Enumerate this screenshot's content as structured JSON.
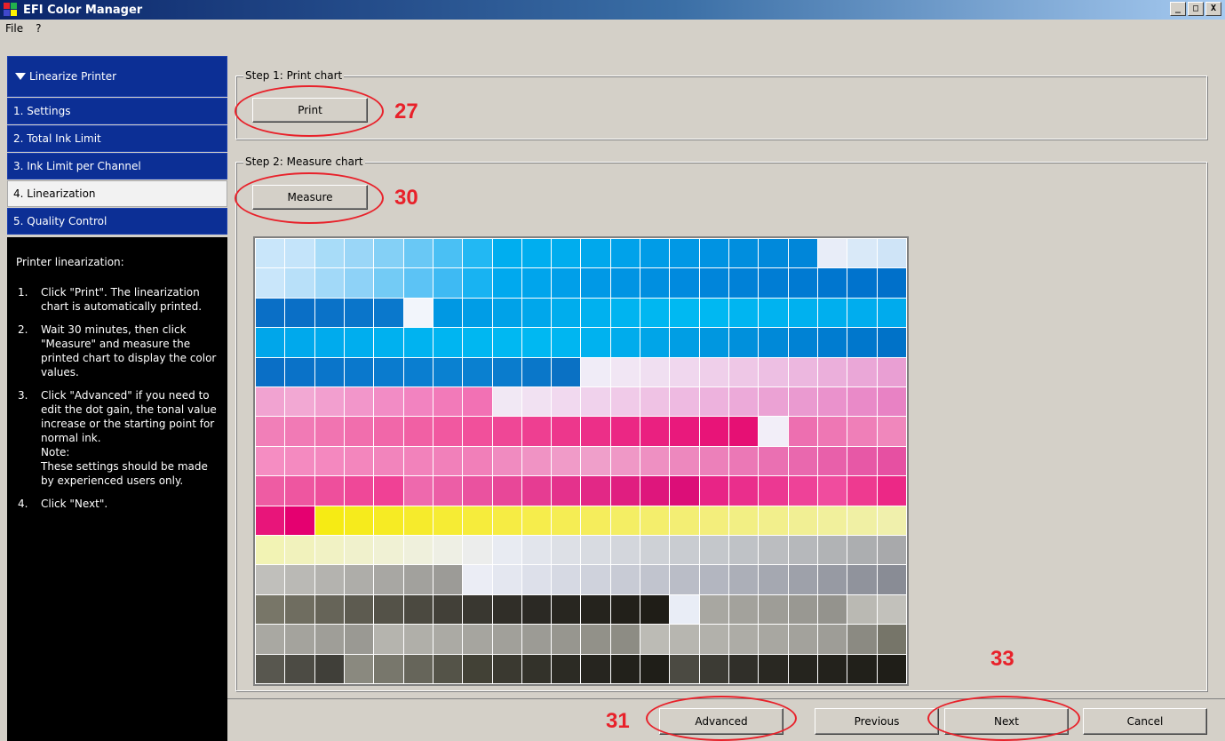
{
  "window": {
    "title": "EFI Color Manager",
    "minimize": "_",
    "maximize": "□",
    "close": "X"
  },
  "menu": [
    "File",
    "?"
  ],
  "sidebar": {
    "header": "Linearize Printer",
    "items": [
      {
        "label": "1. Settings",
        "active": false
      },
      {
        "label": "2. Total Ink Limit",
        "active": false
      },
      {
        "label": "3. Ink Limit per Channel",
        "active": false
      },
      {
        "label": "4. Linearization",
        "active": true
      },
      {
        "label": "5. Quality Control",
        "active": false
      }
    ]
  },
  "help": {
    "title": "Printer linearization:",
    "steps": [
      {
        "num": "1.",
        "text": "Click \"Print\". The linearization chart is automatically printed."
      },
      {
        "num": "2.",
        "text": "Wait 30 minutes, then click \"Measure\" and measure the printed chart to display the color values."
      },
      {
        "num": "3.",
        "text": "Click \"Advanced\" if you need to edit the dot gain, the tonal value increase or the starting point for normal ink."
      },
      {
        "num": "",
        "text": "Note:"
      },
      {
        "num": "",
        "text": "These settings should be made by experienced users only."
      },
      {
        "num": "4.",
        "text": "Click \"Next\"."
      }
    ]
  },
  "step1": {
    "legend": "Step 1: Print chart",
    "button": "Print"
  },
  "step2": {
    "legend": "Step 2: Measure chart",
    "button": "Measure"
  },
  "bottom": {
    "advanced": "Advanced",
    "previous": "Previous",
    "next": "Next",
    "cancel": "Cancel"
  },
  "annotations": {
    "print": "27",
    "measure": "30",
    "advanced": "31",
    "next": "33"
  },
  "colors": {
    "annotation": "#e8212a",
    "nav_blue": "#0c2f95"
  },
  "patch_rows": [
    [
      "#c9e6fa",
      "#c4e4fa",
      "#a8dcf8",
      "#9ad6f7",
      "#84d0f6",
      "#69c8f5",
      "#4ac0f4",
      "#22b8f3",
      "#00aeef",
      "#00aeef",
      "#00adee",
      "#00a8ec",
      "#00a2ea",
      "#009ce7",
      "#0098e5",
      "#0093e2",
      "#008ede",
      "#0089db",
      "#0086d9",
      "#e8edf8",
      "#d9e9f8",
      "#cfe4f7"
    ],
    [
      "#c9e6fa",
      "#b8e0f9",
      "#a2d9f8",
      "#8ed2f7",
      "#73cbf5",
      "#5cc3f5",
      "#3ebaf3",
      "#18b3f2",
      "#00a9ee",
      "#00a5ec",
      "#009fe9",
      "#0099e6",
      "#0094e3",
      "#008fe0",
      "#008ade",
      "#0085da",
      "#0081d7",
      "#007dd4",
      "#007ad2",
      "#0076cf",
      "#0073cd",
      "#0070ca"
    ],
    [
      "#0a6fc6",
      "#0a6fc6",
      "#0a72c8",
      "#0a75ca",
      "#0a78cc",
      "#f2f5fb",
      "#0098e3",
      "#009de6",
      "#00a2e8",
      "#00a7eb",
      "#00aded",
      "#00b1ef",
      "#00b4f0",
      "#00b7f1",
      "#00b9f2",
      "#00b8f2",
      "#00b5f1",
      "#00b3f0",
      "#00b1ef",
      "#00afee",
      "#00adee",
      "#00abed"
    ],
    [
      "#00a6ea",
      "#00a9ec",
      "#00abed",
      "#00aeee",
      "#00b1ef",
      "#00b3f0",
      "#00b5f1",
      "#00b7f1",
      "#00b8f2",
      "#00b8f2",
      "#00b6f1",
      "#00b2ef",
      "#00acec",
      "#00a5e8",
      "#009ee4",
      "#0097e0",
      "#0090dc",
      "#0089d8",
      "#0082d4",
      "#007cd0",
      "#0077cc",
      "#0072c8"
    ],
    [
      "#0a6fc6",
      "#0a72c8",
      "#0a75ca",
      "#0a78cc",
      "#0a7bce",
      "#0a7ed0",
      "#0a81d1",
      "#0a80d0",
      "#0a7ccd",
      "#0a77c9",
      "#0a71c4",
      "#f0ecf7",
      "#f1e6f4",
      "#f0dff1",
      "#f0d7ee",
      "#efcfea",
      "#eec7e6",
      "#edbfe3",
      "#ecb7df",
      "#ebafdb",
      "#eaa7d7",
      "#e99fd3"
    ],
    [
      "#f1a3d1",
      "#f2a8d3",
      "#f29fcf",
      "#f296ca",
      "#f28cc5",
      "#f283c0",
      "#f27ab9",
      "#f271b4",
      "#f1e8f4",
      "#f1e1f2",
      "#f1d9ef",
      "#f0d2ec",
      "#f0cae8",
      "#efc2e4",
      "#eebae1",
      "#edb2dd",
      "#ecaad9",
      "#eba2d4",
      "#ea9ad0",
      "#ea92cc",
      "#e98ac8",
      "#e882c4"
    ],
    [
      "#f17fb8",
      "#f17ab5",
      "#f174b1",
      "#f16ead",
      "#f167a9",
      "#f160a4",
      "#f158a0",
      "#f1509b",
      "#ef4796",
      "#ee3f91",
      "#ed378c",
      "#ec2f88",
      "#eb2784",
      "#ea2080",
      "#e9197c",
      "#e81478",
      "#e61074",
      "#f2eef8",
      "#ed6fb0",
      "#ee77b4",
      "#ef7fb8",
      "#f087bc"
    ],
    [
      "#f58dc2",
      "#f48ac0",
      "#f488bf",
      "#f386bd",
      "#f284bc",
      "#f282bb",
      "#f180ba",
      "#f17fb9",
      "#f08bc0",
      "#f093c4",
      "#f09bc8",
      "#ef9fca",
      "#ef98c6",
      "#ee90c2",
      "#ed88be",
      "#ec80ba",
      "#eb78b6",
      "#ea70b2",
      "#e968ae",
      "#e860aa",
      "#e758a6",
      "#e650a2"
    ],
    [
      "#ee5ca3",
      "#ee56a0",
      "#ee4f9c",
      "#ef4898",
      "#f04195",
      "#ee69ad",
      "#ec5ea6",
      "#ea529f",
      "#e84798",
      "#e63c92",
      "#e4328c",
      "#e22886",
      "#e01e80",
      "#de167c",
      "#dc0e78",
      "#e82486",
      "#ea2e8c",
      "#ec3892",
      "#ee4298",
      "#f04c9e",
      "#ee3a90",
      "#ec2886"
    ],
    [
      "#e8157a",
      "#e50070",
      "#f6eb14",
      "#f6eb1c",
      "#f6eb24",
      "#f6eb2c",
      "#f6ec34",
      "#f6ec3c",
      "#f6ec44",
      "#f6ed4c",
      "#f5ed54",
      "#f5ed5c",
      "#f4ee64",
      "#f4ee6c",
      "#f3ee74",
      "#f3ee7c",
      "#f2ef84",
      "#f2ef8c",
      "#f1ef94",
      "#f1f09c",
      "#f0f0a4",
      "#f0f0ac"
    ],
    [
      "#f2f3b4",
      "#f1f2bc",
      "#f1f2c4",
      "#f0f1cc",
      "#f0f1d4",
      "#eff0dc",
      "#eeefe4",
      "#ecedec",
      "#e8ebf2",
      "#e2e5ec",
      "#dde0e6",
      "#d8dbe1",
      "#d3d6dc",
      "#ced1d6",
      "#c9ccd1",
      "#c4c7cb",
      "#bfc2c6",
      "#bbbdc0",
      "#b6b8bb",
      "#b1b3b5",
      "#acaeb0",
      "#a8a9ab"
    ],
    [
      "#c0bfbb",
      "#bab9b5",
      "#b4b3af",
      "#aeada9",
      "#a8a7a3",
      "#a2a19d",
      "#9c9b97",
      "#ebedf5",
      "#e4e7f0",
      "#dde0ea",
      "#d6d9e3",
      "#cfd2dc",
      "#c8cbd5",
      "#c1c4ce",
      "#babdc7",
      "#b3b6c0",
      "#acafb8",
      "#a5a8b1",
      "#9ea1aa",
      "#979aa3",
      "#90939c",
      "#898c95"
    ],
    [
      "#787668",
      "#6f6d60",
      "#666458",
      "#5d5b50",
      "#545248",
      "#4b4940",
      "#424038",
      "#393730",
      "#302e28",
      "#2b2924",
      "#282620",
      "#25231d",
      "#22201a",
      "#1f1d17",
      "#e9edf6",
      "#a8a7a1",
      "#a3a29c",
      "#9e9d97",
      "#999892",
      "#94938d",
      "#bab9b3",
      "#c2c1bb"
    ],
    [
      "#a9a8a2",
      "#a4a39d",
      "#9f9e98",
      "#9a9993",
      "#b5b4ae",
      "#b0afa9",
      "#abaaa4",
      "#a6a59f",
      "#a1a09a",
      "#9c9b95",
      "#97968f",
      "#929189",
      "#8d8c84",
      "#bcbbb5",
      "#b7b6b0",
      "#b2b1ab",
      "#adaca6",
      "#a8a7a1",
      "#a3a29c",
      "#9e9d97",
      "#8b8a82",
      "#767569"
    ],
    [
      "#58574f",
      "#4c4b44",
      "#403f39",
      "#8a897f",
      "#78776c",
      "#66655a",
      "#545348",
      "#424136",
      "#3a3930",
      "#33322a",
      "#2c2b24",
      "#26251f",
      "#22211b",
      "#1f1e18",
      "#4b4a42",
      "#3c3b34",
      "#302f29",
      "#292822",
      "#25241e",
      "#23221c",
      "#21201a",
      "#1f1e18"
    ]
  ]
}
